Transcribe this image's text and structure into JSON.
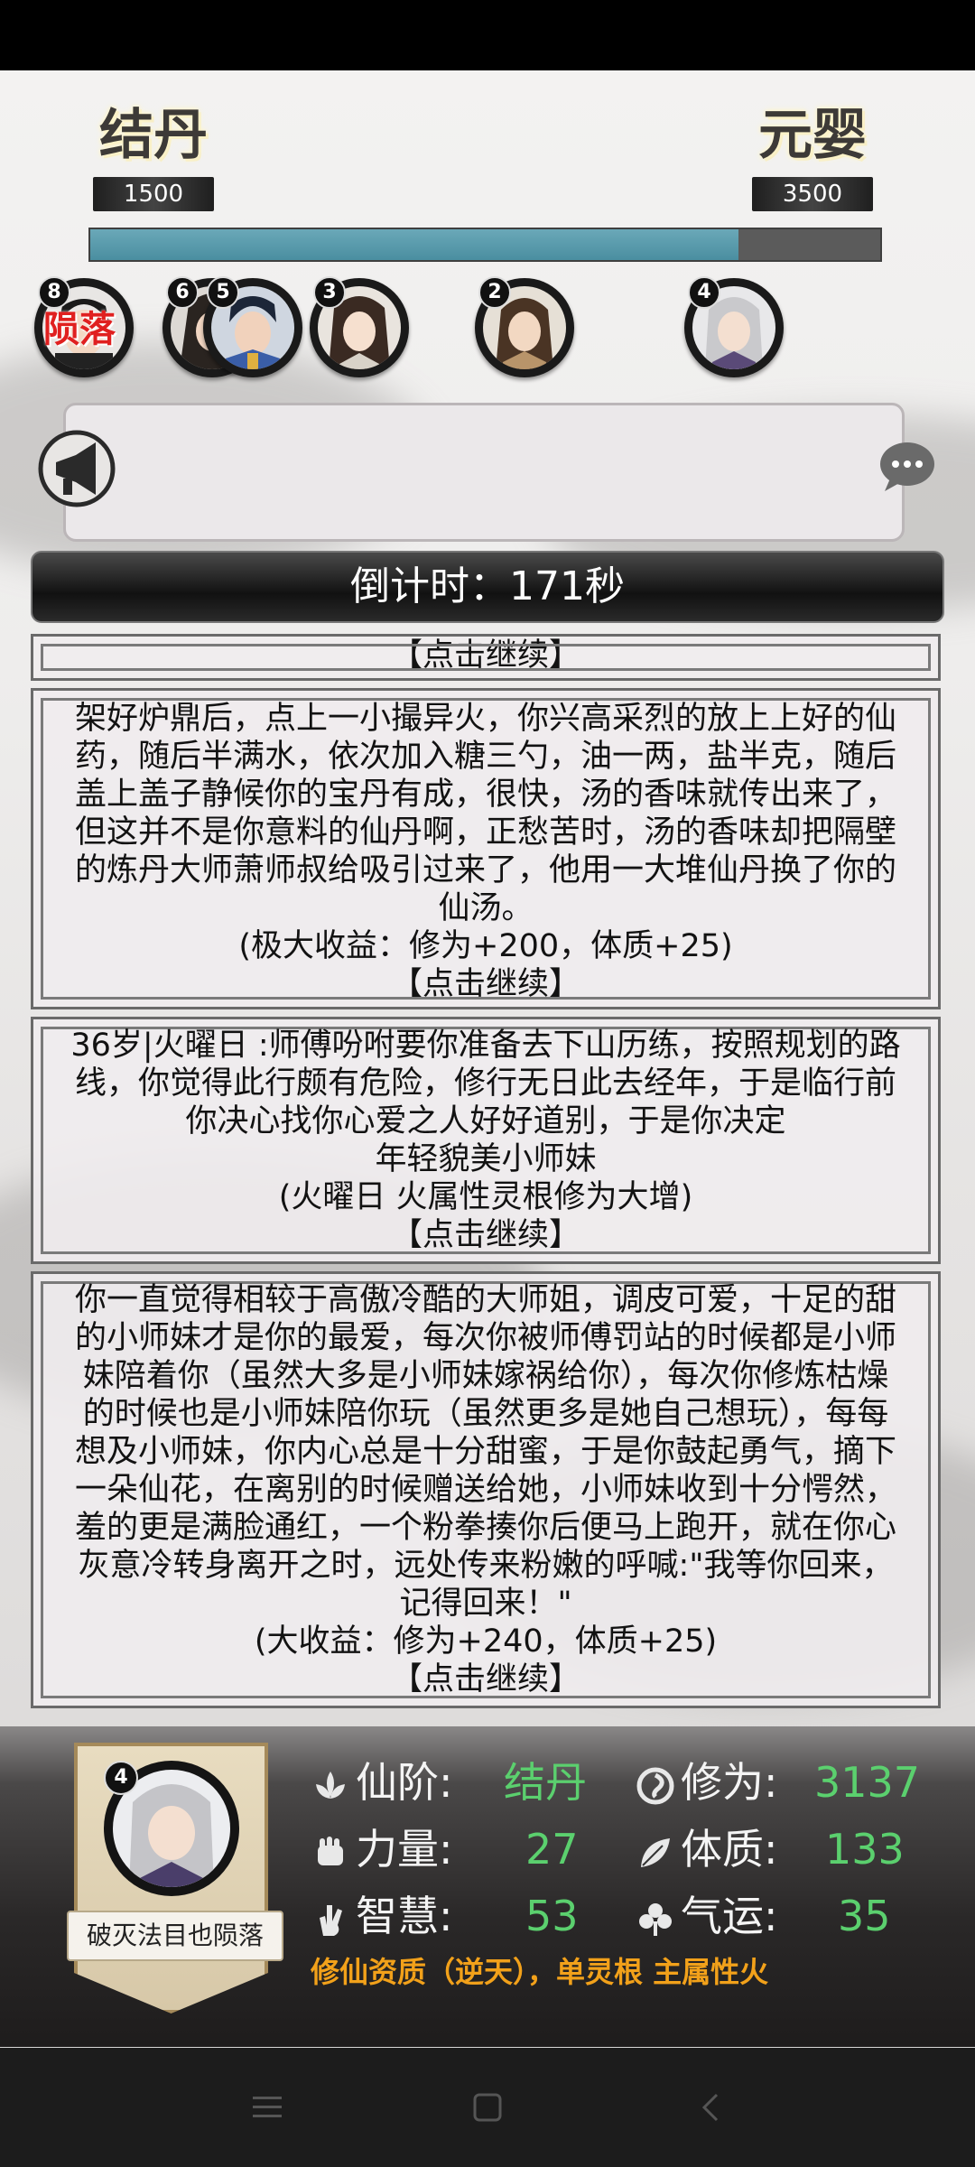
{
  "realms": {
    "current": {
      "name": "结丹",
      "value": "1500"
    },
    "next": {
      "name": "元婴",
      "value": "3500"
    }
  },
  "cultivation_progress": 0.82,
  "avatars": [
    {
      "badge": "8",
      "status": "陨落"
    },
    {
      "badge": "6"
    },
    {
      "badge": "5"
    },
    {
      "badge": "3"
    },
    {
      "badge": "2"
    },
    {
      "badge": "4"
    }
  ],
  "countdown": "倒计时：171秒",
  "events": [
    {
      "continue": "【点击继续】"
    },
    {
      "text": "架好炉鼎后，点上一小撮异火，你兴高采烈的放上上好的仙药，随后半满水，依次加入糖三勺，油一两，盐半克，随后盖上盖子静候你的宝丹有成，很快，汤的香味就传出来了，但这并不是你意料的仙丹啊，正愁苦时，汤的香味却把隔壁的炼丹大师萧师叔给吸引过来了，他用一大堆仙丹换了你的仙汤。",
      "reward": "(极大收益：修为+200，体质+25)",
      "continue": "【点击继续】"
    },
    {
      "text": "36岁|火曜日 :师傅吩咐要你准备去下山历练，按照规划的路线，你觉得此行颇有危险，修行无日此去经年，于是临行前你决心找你心爱之人好好道别，于是你决定",
      "highlight1": "年轻貌美小师妹",
      "highlight2": "(火曜日 火属性灵根修为大增)",
      "continue": "【点击继续】"
    },
    {
      "text": "你一直觉得相较于高傲冷酷的大师姐，调皮可爱，十足的甜的小师妹才是你的最爱，每次你被师傅罚站的时候都是小师妹陪着你（虽然大多是小师妹嫁祸给你），每次你修炼枯燥的时候也是小师妹陪你玩（虽然更多是她自己想玩），每每想及小师妹，你内心总是十分甜蜜，于是你鼓起勇气，摘下一朵仙花，在离别的时候赠送给她，小师妹收到十分愕然，羞的更是满脸通红，一个粉拳揍你后便马上跑开，就在你心灰意冷转身离开之时，远处传来粉嫩的呼喊:\"我等你回来，记得回来！\"",
      "reward": "(大收益：修为+240，体质+25)",
      "continue": "【点击继续】"
    }
  ],
  "character": {
    "badge": "4",
    "title": "破灭法目也陨落",
    "stats": {
      "realm": {
        "label": "仙阶:",
        "value": "结丹"
      },
      "cultivation": {
        "label": "修为:",
        "value": "3137"
      },
      "strength": {
        "label": "力量:",
        "value": "27"
      },
      "constitution": {
        "label": "体质:",
        "value": "133"
      },
      "wisdom": {
        "label": "智慧:",
        "value": "53"
      },
      "luck": {
        "label": "气运:",
        "value": "35"
      }
    },
    "aptitude": "修仙资质（逆天），单灵根 主属性火"
  },
  "icons": {
    "announcement": "horn-icon",
    "chat": "chat-bubble-icon",
    "nav_menu": "menu-icon",
    "nav_home": "home-icon",
    "nav_back": "back-icon"
  },
  "colors": {
    "progress": "#4a8ea0",
    "stat_value": "#5bd06e",
    "highlight": "#f2990a",
    "fallen": "#e02020"
  }
}
